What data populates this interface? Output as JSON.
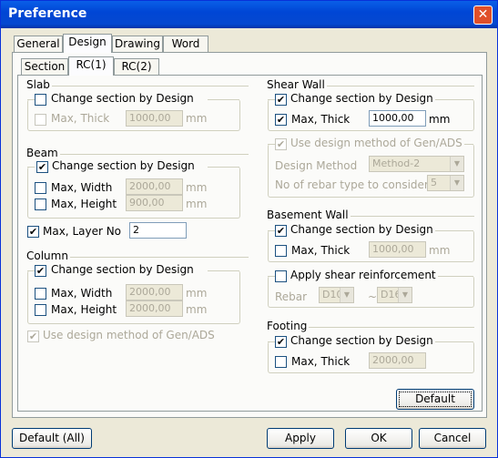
{
  "title": "Preference",
  "tabs": [
    "General",
    "Design",
    "Drawing",
    "Word"
  ],
  "subtabs": [
    "Section",
    "RC(1)",
    "RC(2)"
  ],
  "slab": {
    "title": "Slab",
    "change": "Change section by Design",
    "max_thick": "Max, Thick",
    "max_thick_val": "1000,00",
    "unit": "mm"
  },
  "beam": {
    "title": "Beam",
    "change": "Change section by Design",
    "max_width": "Max, Width",
    "max_width_val": "2000,00",
    "max_height": "Max, Height",
    "max_height_val": "900,00",
    "unit": "mm",
    "max_layer": "Max, Layer No",
    "max_layer_val": "2"
  },
  "column": {
    "title": "Column",
    "change": "Change section by Design",
    "max_width": "Max, Width",
    "max_width_val": "2000,00",
    "max_height": "Max, Height",
    "max_height_val": "2000,00",
    "unit": "mm",
    "use_design": "Use design method of Gen/ADS"
  },
  "shear_wall": {
    "title": "Shear Wall",
    "change": "Change section by Design",
    "max_thick": "Max, Thick",
    "max_thick_val": "1000,00",
    "unit": "mm",
    "use_design": "Use design method of Gen/ADS",
    "design_method": "Design Method",
    "design_method_val": "Method-2",
    "rebar_types": "No of rebar type to consider",
    "rebar_types_val": "5"
  },
  "basement_wall": {
    "title": "Basement Wall",
    "change": "Change section by Design",
    "max_thick": "Max, Thick",
    "max_thick_val": "1000,00",
    "unit": "mm",
    "apply_shear": "Apply shear reinforcement",
    "rebar": "Rebar",
    "rebar_from": "D10",
    "rebar_sep": "~",
    "rebar_to": "D16"
  },
  "footing": {
    "title": "Footing",
    "change": "Change section by Design",
    "max_thick": "Max, Thick",
    "max_thick_val": "2000,00"
  },
  "buttons": {
    "default": "Default",
    "default_all": "Default (All)",
    "apply": "Apply",
    "ok": "OK",
    "cancel": "Cancel"
  },
  "check_mark": "✔",
  "close_glyph": "✕",
  "arrow_glyph": "▼"
}
